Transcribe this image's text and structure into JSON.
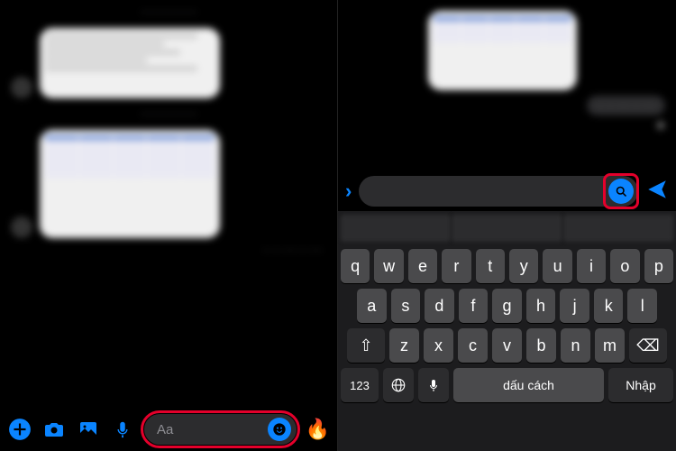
{
  "left": {
    "composer": {
      "placeholder": "Aa",
      "reaction_emoji": "🔥"
    }
  },
  "right": {
    "search_bar": {
      "expand_icon": "›"
    }
  },
  "keyboard": {
    "suggestions": [
      "",
      "",
      ""
    ],
    "row1": [
      "q",
      "w",
      "e",
      "r",
      "t",
      "y",
      "u",
      "i",
      "o",
      "p"
    ],
    "row2": [
      "a",
      "s",
      "d",
      "f",
      "g",
      "h",
      "j",
      "k",
      "l"
    ],
    "row3": [
      "z",
      "x",
      "c",
      "v",
      "b",
      "n",
      "m"
    ],
    "shift_label": "⇧",
    "backspace_label": "⌫",
    "numbers_label": "123",
    "globe_label": "🌐",
    "mic_label": "🎤",
    "space_label": "dấu cách",
    "enter_label": "Nhập"
  },
  "icons": {
    "plus": "plus-icon",
    "camera": "camera-icon",
    "photo": "photo-icon",
    "microphone": "microphone-icon",
    "emoji": "emoji-icon",
    "search": "search-icon",
    "send": "send-icon"
  }
}
